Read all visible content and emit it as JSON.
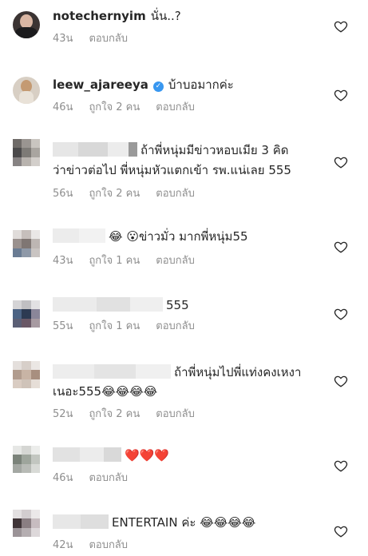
{
  "comments": [
    {
      "username": "notechernyim",
      "text": "นั่น..?",
      "time": "43น",
      "likes": "",
      "reply": "ตอบกลับ"
    },
    {
      "username": "leew_ajareeya",
      "text": "บ้าบอมากค่ะ",
      "time": "46น",
      "likes": "ถูกใจ 2 คน",
      "reply": "ตอบกลับ"
    },
    {
      "username": "",
      "text": "ถ้าพี่หนุ่มมีข่าวหอบเมีย 3 คิด",
      "text2": "ว่าข่าวต่อไป  พี่หนุ่มหัวแตกเข้า รพ.แน่เลย 555",
      "time": "56น",
      "likes": "ถูกใจ 2 คน",
      "reply": "ตอบกลับ"
    },
    {
      "username": "",
      "emoji_a": "😂",
      "emoji_b": "😮",
      "text": "ข่าวมั่ว มากพี่หนุ่ม55",
      "time": "43น",
      "likes": "ถูกใจ 1 คน",
      "reply": "ตอบกลับ"
    },
    {
      "username": "",
      "text": "555",
      "time": "55น",
      "likes": "ถูกใจ 1 คน",
      "reply": "ตอบกลับ"
    },
    {
      "username": "",
      "text": "ถ้าพี่หนุ่มไปพี่แท่งคงเหงา",
      "text2": "เนอะ555",
      "emojis2": "😂😂😂😂",
      "time": "52น",
      "likes": "ถูกใจ 2 คน",
      "reply": "ตอบกลับ"
    },
    {
      "username": "",
      "text": "❤️❤️❤️",
      "time": "46น",
      "likes": "",
      "reply": "ตอบกลับ"
    },
    {
      "username": "",
      "text": "ENTERTAIN ค่ะ",
      "emojis": "😂😂😂😂",
      "time": "42น",
      "likes": "",
      "reply": "ตอบกลับ"
    }
  ],
  "icons": {
    "like": "heart-outline-icon",
    "verified": "verified-badge-icon"
  },
  "colors": {
    "text": "#262626",
    "meta": "#8e8e8e",
    "verified": "#3897f0"
  }
}
